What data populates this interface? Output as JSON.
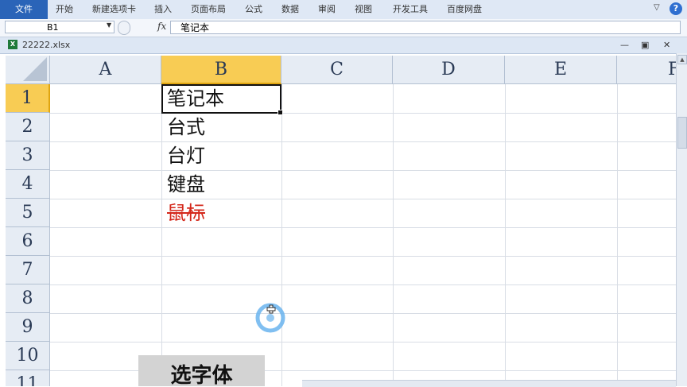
{
  "ribbon": {
    "file_tab": "文件",
    "tabs": [
      "开始",
      "新建选项卡",
      "插入",
      "页面布局",
      "公式",
      "数据",
      "审阅",
      "视图",
      "开发工具",
      "百度网盘"
    ],
    "help": "?"
  },
  "formula_bar": {
    "name_box": "B1",
    "fx_label": "fx",
    "content": "笔记本"
  },
  "workbook": {
    "filename": "22222.xlsx",
    "icon_text": "X"
  },
  "sheet": {
    "columns": [
      "A",
      "B",
      "C",
      "D",
      "E",
      "F"
    ],
    "rows": [
      "1",
      "2",
      "3",
      "4",
      "5",
      "6",
      "7",
      "8",
      "9",
      "10",
      "11"
    ],
    "cells": [
      "笔记本",
      "台式",
      "台灯",
      "键盘",
      "鼠标"
    ],
    "selected_cell": "B1"
  },
  "overlay": {
    "caption": "选字体"
  },
  "colors": {
    "file_tab": "#2a64b8",
    "selected_header": "#f8cc54",
    "strike_text": "#d4281b"
  }
}
